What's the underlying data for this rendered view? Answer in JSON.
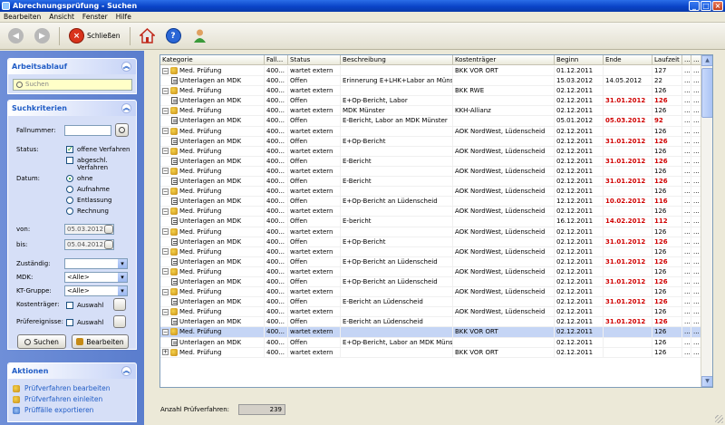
{
  "window": {
    "title": "Abrechnungsprüfung - Suchen"
  },
  "menu": [
    "Bearbeiten",
    "Ansicht",
    "Fenster",
    "Hilfe"
  ],
  "toolbar": {
    "close_label": "Schließen"
  },
  "arbeitsablauf": {
    "title": "Arbeitsablauf",
    "search_placeholder": "Suchen"
  },
  "suchkriterien": {
    "title": "Suchkriterien",
    "fallnummer_label": "Fallnummer:",
    "status_label": "Status:",
    "status_offene": "offene Verfahren",
    "status_abgeschl": "abgeschl. Verfahren",
    "datum_label": "Datum:",
    "datum_options": [
      "ohne",
      "Aufnahme",
      "Entlassung",
      "Rechnung"
    ],
    "von_label": "von:",
    "von_value": "05.03.2012",
    "bis_label": "bis:",
    "bis_value": "05.04.2012",
    "zustaendig_label": "Zuständig:",
    "mdk_label": "MDK:",
    "mdk_value": "<Alle>",
    "ktgruppe_label": "KT-Gruppe:",
    "ktgruppe_value": "<Alle>",
    "kostentraeger_label": "Kostenträger:",
    "pruefereignisse_label": "Prüfereignisse:",
    "auswahl_label": "Auswahl",
    "search_button": "Suchen",
    "edit_button": "Bearbeiten"
  },
  "aktionen": {
    "title": "Aktionen",
    "links": [
      "Prüfverfahren bearbeiten",
      "Prüfverfahren einleiten",
      "Prüffälle exportieren"
    ]
  },
  "grid": {
    "columns": [
      "Kategorie",
      "Fall...",
      "Status",
      "Beschreibung",
      "Kostenträger",
      "Beginn",
      "Ende",
      "Laufzeit",
      "...",
      "..."
    ],
    "rows": [
      {
        "lvl": 0,
        "kat": "Med. Prüfung",
        "fall": "400...",
        "status": "wartet extern",
        "besch": "",
        "kt": "BKK VOR ORT",
        "beginn": "01.12.2011",
        "ende": "",
        "lz": "127",
        "red": false
      },
      {
        "lvl": 1,
        "kat": "Unterlagen an MDK",
        "fall": "400...",
        "status": "Offen",
        "besch": "Erinnerung E+LHK+Labor an Münste...",
        "kt": "",
        "beginn": "15.03.2012",
        "ende": "14.05.2012",
        "lz": "22",
        "red": false
      },
      {
        "lvl": 0,
        "kat": "Med. Prüfung",
        "fall": "400...",
        "status": "wartet extern",
        "besch": "",
        "kt": "BKK RWE",
        "beginn": "02.12.2011",
        "ende": "",
        "lz": "126",
        "red": false
      },
      {
        "lvl": 1,
        "kat": "Unterlagen an MDK",
        "fall": "400...",
        "status": "Offen",
        "besch": "E+Op-Bericht, Labor",
        "kt": "",
        "beginn": "02.12.2011",
        "ende": "31.01.2012",
        "lz": "126",
        "red": true
      },
      {
        "lvl": 0,
        "kat": "Med. Prüfung",
        "fall": "400...",
        "status": "wartet extern",
        "besch": "MDK Münster",
        "kt": "KKH-Allianz",
        "beginn": "02.12.2011",
        "ende": "",
        "lz": "126",
        "red": false
      },
      {
        "lvl": 1,
        "kat": "Unterlagen an MDK",
        "fall": "400...",
        "status": "Offen",
        "besch": "E-Bericht, Labor an MDK Münster",
        "kt": "",
        "beginn": "05.01.2012",
        "ende": "05.03.2012",
        "lz": "92",
        "red": true
      },
      {
        "lvl": 0,
        "kat": "Med. Prüfung",
        "fall": "400...",
        "status": "wartet extern",
        "besch": "",
        "kt": "AOK NordWest, Lüdenscheid",
        "beginn": "02.12.2011",
        "ende": "",
        "lz": "126",
        "red": false
      },
      {
        "lvl": 1,
        "kat": "Unterlagen an MDK",
        "fall": "400...",
        "status": "Offen",
        "besch": "E+Op-Bericht",
        "kt": "",
        "beginn": "02.12.2011",
        "ende": "31.01.2012",
        "lz": "126",
        "red": true
      },
      {
        "lvl": 0,
        "kat": "Med. Prüfung",
        "fall": "400...",
        "status": "wartet extern",
        "besch": "",
        "kt": "AOK NordWest, Lüdenscheid",
        "beginn": "02.12.2011",
        "ende": "",
        "lz": "126",
        "red": false
      },
      {
        "lvl": 1,
        "kat": "Unterlagen an MDK",
        "fall": "400...",
        "status": "Offen",
        "besch": "E-Bericht",
        "kt": "",
        "beginn": "02.12.2011",
        "ende": "31.01.2012",
        "lz": "126",
        "red": true
      },
      {
        "lvl": 0,
        "kat": "Med. Prüfung",
        "fall": "400...",
        "status": "wartet extern",
        "besch": "",
        "kt": "AOK NordWest, Lüdenscheid",
        "beginn": "02.12.2011",
        "ende": "",
        "lz": "126",
        "red": false
      },
      {
        "lvl": 1,
        "kat": "Unterlagen an MDK",
        "fall": "400...",
        "status": "Offen",
        "besch": "E-Bericht",
        "kt": "",
        "beginn": "02.12.2011",
        "ende": "31.01.2012",
        "lz": "126",
        "red": true
      },
      {
        "lvl": 0,
        "kat": "Med. Prüfung",
        "fall": "400...",
        "status": "wartet extern",
        "besch": "",
        "kt": "AOK NordWest, Lüdenscheid",
        "beginn": "02.12.2011",
        "ende": "",
        "lz": "126",
        "red": false
      },
      {
        "lvl": 1,
        "kat": "Unterlagen an MDK",
        "fall": "400...",
        "status": "Offen",
        "besch": "E+Op-Bericht an Lüdenscheid",
        "kt": "",
        "beginn": "12.12.2011",
        "ende": "10.02.2012",
        "lz": "116",
        "red": true
      },
      {
        "lvl": 0,
        "kat": "Med. Prüfung",
        "fall": "400...",
        "status": "wartet extern",
        "besch": "",
        "kt": "AOK NordWest, Lüdenscheid",
        "beginn": "02.12.2011",
        "ende": "",
        "lz": "126",
        "red": false
      },
      {
        "lvl": 1,
        "kat": "Unterlagen an MDK",
        "fall": "400...",
        "status": "Offen",
        "besch": "E-bericht",
        "kt": "",
        "beginn": "16.12.2011",
        "ende": "14.02.2012",
        "lz": "112",
        "red": true
      },
      {
        "lvl": 0,
        "kat": "Med. Prüfung",
        "fall": "400...",
        "status": "wartet extern",
        "besch": "",
        "kt": "AOK NordWest, Lüdenscheid",
        "beginn": "02.12.2011",
        "ende": "",
        "lz": "126",
        "red": false
      },
      {
        "lvl": 1,
        "kat": "Unterlagen an MDK",
        "fall": "400...",
        "status": "Offen",
        "besch": "E+Op-Bericht",
        "kt": "",
        "beginn": "02.12.2011",
        "ende": "31.01.2012",
        "lz": "126",
        "red": true
      },
      {
        "lvl": 0,
        "kat": "Med. Prüfung",
        "fall": "400...",
        "status": "wartet extern",
        "besch": "",
        "kt": "AOK NordWest, Lüdenscheid",
        "beginn": "02.12.2011",
        "ende": "",
        "lz": "126",
        "red": false
      },
      {
        "lvl": 1,
        "kat": "Unterlagen an MDK",
        "fall": "400...",
        "status": "Offen",
        "besch": "E+Op-Bericht an Lüdenscheid",
        "kt": "",
        "beginn": "02.12.2011",
        "ende": "31.01.2012",
        "lz": "126",
        "red": true
      },
      {
        "lvl": 0,
        "kat": "Med. Prüfung",
        "fall": "400...",
        "status": "wartet extern",
        "besch": "",
        "kt": "AOK NordWest, Lüdenscheid",
        "beginn": "02.12.2011",
        "ende": "",
        "lz": "126",
        "red": false
      },
      {
        "lvl": 1,
        "kat": "Unterlagen an MDK",
        "fall": "400...",
        "status": "Offen",
        "besch": "E+Op-Bericht an Lüdenscheid",
        "kt": "",
        "beginn": "02.12.2011",
        "ende": "31.01.2012",
        "lz": "126",
        "red": true
      },
      {
        "lvl": 0,
        "kat": "Med. Prüfung",
        "fall": "400...",
        "status": "wartet extern",
        "besch": "",
        "kt": "AOK NordWest, Lüdenscheid",
        "beginn": "02.12.2011",
        "ende": "",
        "lz": "126",
        "red": false
      },
      {
        "lvl": 1,
        "kat": "Unterlagen an MDK",
        "fall": "400...",
        "status": "Offen",
        "besch": "E-Bericht an Lüdenscheid",
        "kt": "",
        "beginn": "02.12.2011",
        "ende": "31.01.2012",
        "lz": "126",
        "red": true
      },
      {
        "lvl": 0,
        "kat": "Med. Prüfung",
        "fall": "400...",
        "status": "wartet extern",
        "besch": "",
        "kt": "AOK NordWest, Lüdenscheid",
        "beginn": "02.12.2011",
        "ende": "",
        "lz": "126",
        "red": false
      },
      {
        "lvl": 1,
        "kat": "Unterlagen an MDK",
        "fall": "400...",
        "status": "Offen",
        "besch": "E-Bericht an Lüdenscheid",
        "kt": "",
        "beginn": "02.12.2011",
        "ende": "31.01.2012",
        "lz": "126",
        "red": true
      },
      {
        "lvl": 0,
        "kat": "Med. Prüfung",
        "fall": "400...",
        "status": "wartet extern",
        "besch": "",
        "kt": "BKK VOR ORT",
        "beginn": "02.12.2011",
        "ende": "",
        "lz": "126",
        "red": false,
        "sel": true
      },
      {
        "lvl": 1,
        "kat": "Unterlagen an MDK",
        "fall": "400...",
        "status": "Offen",
        "besch": "E+Op-Bericht, Labor an MDK Münster",
        "kt": "",
        "beginn": "02.12.2011",
        "ende": "",
        "lz": "126",
        "red": false
      },
      {
        "lvl": 0,
        "kat": "Med. Prüfung",
        "fall": "400...",
        "status": "wartet extern",
        "besch": "",
        "kt": "BKK VOR ORT",
        "beginn": "02.12.2011",
        "ende": "",
        "lz": "126",
        "red": false,
        "plus": true
      }
    ]
  },
  "footer": {
    "count_label": "Anzahl Prüfverfahren:",
    "count_value": "239"
  }
}
